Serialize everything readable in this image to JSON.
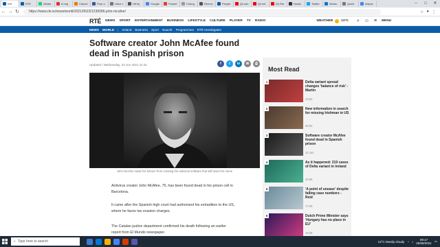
{
  "browser": {
    "tabs": [
      {
        "title": "Sof",
        "color": "#0c5da9",
        "active": true
      },
      {
        "title": "RTE",
        "color": "#0c5da9"
      },
      {
        "title": "Whats",
        "color": "#25d366"
      },
      {
        "title": "A maj",
        "color": "#d33"
      },
      {
        "title": "Cancel",
        "color": "#e57c00"
      },
      {
        "title": "Pour o",
        "color": "#3b5998"
      },
      {
        "title": "Have v",
        "color": "#777"
      },
      {
        "title": "Hit by",
        "color": "#555"
      },
      {
        "title": "Google",
        "color": "#4285f4"
      },
      {
        "title": "Powerf",
        "color": "#e53935"
      },
      {
        "title": "Chang",
        "color": "#999"
      },
      {
        "title": "Remov",
        "color": "#555"
      },
      {
        "title": "People",
        "color": "#0c5da9"
      },
      {
        "title": "(5) sub",
        "color": "#e00"
      },
      {
        "title": "(5) hel",
        "color": "#e00"
      },
      {
        "title": "(5) Rot",
        "color": "#e00"
      },
      {
        "title": "Noisin",
        "color": "#333"
      },
      {
        "title": "Twitter",
        "color": "#1da1f2"
      },
      {
        "title": "Windo",
        "color": "#0078d4"
      },
      {
        "title": "Quick",
        "color": "#777"
      },
      {
        "title": "helpwi",
        "color": "#4285f4"
      }
    ],
    "url": "https://www.rte.ie/news/world/2021/0623/1230096-john-mcafee/"
  },
  "site": {
    "logo": "RTÉ",
    "nav": [
      "NEWS",
      "SPORT",
      "ENTERTAINMENT",
      "BUSINESS",
      "LIFESTYLE",
      "CULTURE",
      "PLAYER",
      "TV",
      "RADIO"
    ],
    "weather_label": "WEATHER",
    "temperature": "13°C",
    "menu_label": "MENU",
    "subnav": [
      "NEWS",
      "WORLD",
      "Ireland",
      "Business",
      "Sport",
      "Nuacht",
      "Programmes",
      "RTÉ Investigates"
    ]
  },
  "article": {
    "headline": "Software creator John McAfee found dead in Spanish prison",
    "dateline": "Updated / Wednesday, 23 Jun 2021 21:31",
    "caption": "John McAfee made his fortune from creating the antivirus software that still bears his name",
    "p1": "Antivirus creator John McAfee, 75, has been found dead in his prison cell in Barcelona.",
    "p2": "It came after the Spanish high court had authorised his extradition to the US, where he faces tax evasion charges.",
    "p3": "The Catalan justice department confirmed his death following an earlier report from El Mundo newspaper."
  },
  "most_read": {
    "title": "Most Read",
    "items": [
      {
        "num": "1",
        "text": "Delta variant spread changes 'balance of risk' - Martin",
        "time": "23:52"
      },
      {
        "num": "2",
        "text": "New information in search for missing Irishman in US",
        "time": "06:02"
      },
      {
        "num": "3",
        "text": "Software creator McAfee found dead in Spanish prison",
        "time": "23 Jun"
      },
      {
        "num": "4",
        "text": "As it happened: 210 cases of Delta variant in Ireland",
        "time": "20:08"
      },
      {
        "num": "5",
        "text": "'A point of unease' despite falling case numbers - Reid",
        "time": "17:09"
      },
      {
        "num": "6",
        "text": "Dutch Prime Minister says 'Hungary has no place in EU'",
        "time": "16:35"
      }
    ]
  },
  "taskbar": {
    "search_placeholder": "Type here to search",
    "weather": "13°C  Mostly cloudy",
    "time": "09:17",
    "date": "25/06/2021"
  }
}
